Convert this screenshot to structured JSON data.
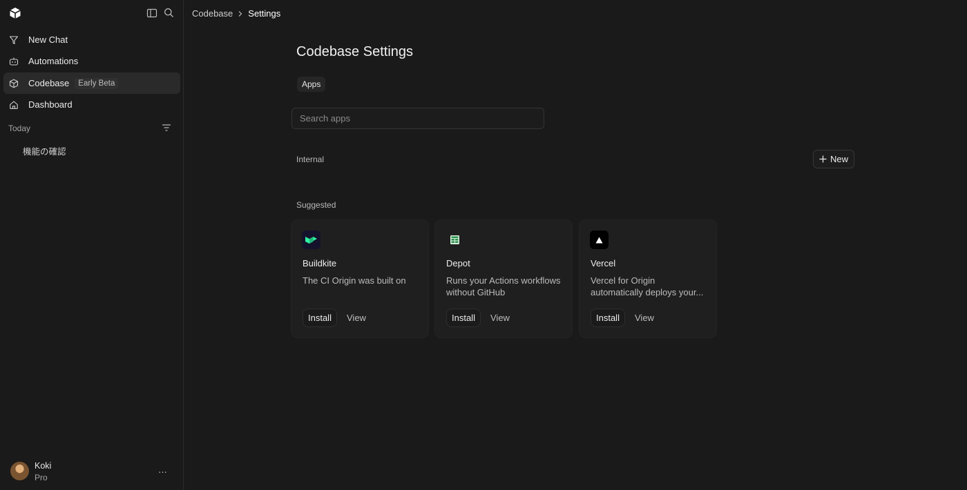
{
  "breadcrumb": {
    "parent": "Codebase",
    "current": "Settings"
  },
  "sidebar": {
    "items": [
      {
        "label": "New Chat",
        "icon": "new-chat-icon"
      },
      {
        "label": "Automations",
        "icon": "robot-icon"
      },
      {
        "label": "Codebase",
        "icon": "cube-icon",
        "badge": "Early Beta",
        "active": true
      },
      {
        "label": "Dashboard",
        "icon": "home-icon"
      }
    ],
    "section_label": "Today",
    "history": [
      {
        "label": "機能の確認"
      }
    ],
    "user": {
      "name": "Koki",
      "plan": "Pro"
    }
  },
  "main": {
    "title": "Codebase Settings",
    "tabs": [
      {
        "label": "Apps",
        "active": true
      }
    ],
    "search": {
      "placeholder": "Search apps",
      "value": ""
    },
    "internal_label": "Internal",
    "new_button_label": "New",
    "suggested_label": "Suggested",
    "apps": [
      {
        "name": "Buildkite",
        "description": "The CI Origin was built on",
        "install_label": "Install",
        "view_label": "View",
        "icon": "buildkite-icon",
        "icon_bg": "#14132b",
        "icon_color": "#30f2a2"
      },
      {
        "name": "Depot",
        "description": "Runs your Actions workflows without GitHub",
        "install_label": "Install",
        "view_label": "View",
        "icon": "depot-icon",
        "icon_bg": "#1f1f1f",
        "icon_color": "#5ad07a"
      },
      {
        "name": "Vercel",
        "description": "Vercel for Origin automatically deploys your...",
        "install_label": "Install",
        "view_label": "View",
        "icon": "vercel-triangle-icon",
        "icon_bg": "#000000",
        "icon_color": "#ffffff"
      }
    ]
  },
  "colors": {
    "background": "#1a1a1a",
    "sidebar_active": "#2a2a2a",
    "card": "#1f1f1f",
    "text": "#ececec",
    "muted_text": "#bcbcbc"
  }
}
